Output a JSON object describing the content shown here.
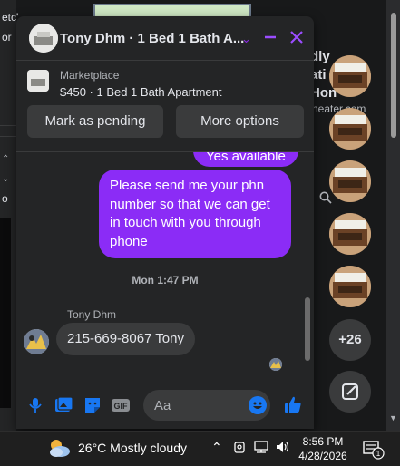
{
  "background": {
    "left_texts": [
      "etc'",
      "or",
      "o"
    ],
    "right_texts": [
      "dly",
      "ati",
      "Hon"
    ],
    "right_link": "neater.com"
  },
  "chat": {
    "contact_name": "Tony Dhm",
    "title": "Tony Dhm · 1 Bed 1 Bath A...",
    "marketplace_label": "Marketplace",
    "listing": "$450 · 1 Bed 1 Bath Apartment",
    "buttons": {
      "pending": "Mark as pending",
      "more": "More options"
    },
    "messages": {
      "partial_out": "Yes available",
      "out": "Please send me your phn number so that we can get in touch with you through phone",
      "timestamp": "Mon 1:47 PM",
      "sender": "Tony Dhm",
      "in": "215-669-8067  Tony"
    },
    "composer": {
      "placeholder": "Aa",
      "gif_label": "GIF"
    },
    "colors": {
      "accent": "#8b2cf6",
      "like": "#1877f2"
    }
  },
  "sidebar": {
    "more_count": "+26"
  },
  "taskbar": {
    "weather": "26°C  Mostly cloudy",
    "time": "8:56 PM",
    "date": "4/28/2026",
    "notifications": "1"
  }
}
